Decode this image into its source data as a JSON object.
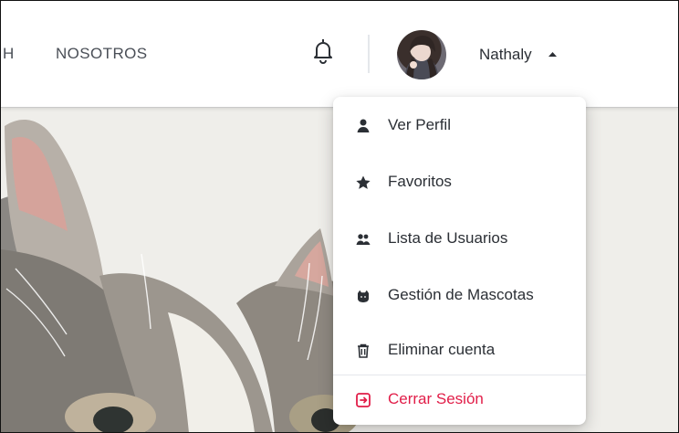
{
  "navbar": {
    "cut_item": "H",
    "about_label": "NOSOTROS",
    "bell_icon": "bell-icon",
    "avatar_icon": "avatar",
    "username": "Nathaly",
    "caret_icon": "caret-up-icon"
  },
  "menu": {
    "items": [
      {
        "label": "Ver Perfil",
        "icon": "user-icon"
      },
      {
        "label": "Favoritos",
        "icon": "star-icon"
      },
      {
        "label": "Lista de Usuarios",
        "icon": "users-icon"
      },
      {
        "label": "Gestión de Mascotas",
        "icon": "cat-icon"
      },
      {
        "label": "Eliminar cuenta",
        "icon": "trash-icon"
      }
    ],
    "logout": {
      "label": "Cerrar Sesión",
      "icon": "logout-icon",
      "color": "#e11d48"
    }
  }
}
